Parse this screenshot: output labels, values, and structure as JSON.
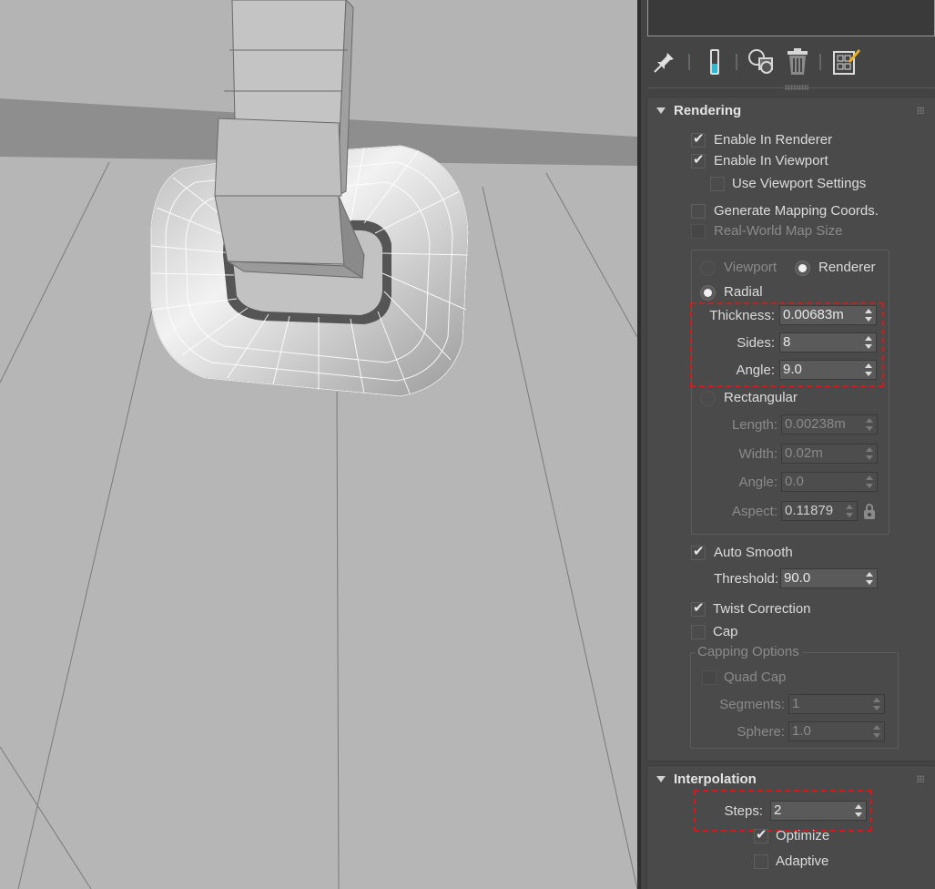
{
  "toolbar": {
    "icons": [
      "pin-stack-icon",
      "show-end-result-icon",
      "make-unique-icon",
      "remove-modifier-icon",
      "configure-modifier-sets-icon"
    ]
  },
  "rendering": {
    "title": "Rendering",
    "enable_in_renderer": {
      "label": "Enable In Renderer",
      "checked": true
    },
    "enable_in_viewport": {
      "label": "Enable In Viewport",
      "checked": true
    },
    "use_viewport_settings": {
      "label": "Use Viewport Settings",
      "checked": false
    },
    "generate_mapping_coords": {
      "label": "Generate Mapping Coords.",
      "checked": false
    },
    "real_world_map_size": {
      "label": "Real-World Map Size",
      "checked": false
    },
    "viewport_radio": "Viewport",
    "renderer_radio": "Renderer",
    "radial": {
      "label": "Radial",
      "thickness_label": "Thickness:",
      "thickness": "0.00683m",
      "sides_label": "Sides:",
      "sides": "8",
      "angle_label": "Angle:",
      "angle": "9.0"
    },
    "rectangular": {
      "label": "Rectangular",
      "length_label": "Length:",
      "length": "0.00238m",
      "width_label": "Width:",
      "width": "0.02m",
      "angle_label": "Angle:",
      "angle": "0.0",
      "aspect_label": "Aspect:",
      "aspect": "0.11879"
    },
    "auto_smooth": {
      "label": "Auto Smooth",
      "checked": true
    },
    "threshold_label": "Threshold:",
    "threshold": "90.0",
    "twist_correction": {
      "label": "Twist Correction",
      "checked": true
    },
    "cap": {
      "label": "Cap",
      "checked": false
    },
    "capping_options": {
      "title": "Capping Options",
      "quad_cap": "Quad Cap",
      "segments_label": "Segments:",
      "segments": "1",
      "sphere_label": "Sphere:",
      "sphere": "1.0"
    }
  },
  "interpolation": {
    "title": "Interpolation",
    "steps_label": "Steps:",
    "steps": "2",
    "optimize": {
      "label": "Optimize",
      "checked": true
    },
    "adaptive": {
      "label": "Adaptive",
      "checked": false
    }
  },
  "colors": {
    "panel_bg": "#444444",
    "viewport_bg": "#b4b4b4",
    "highlight_box": "#d11a1a"
  }
}
